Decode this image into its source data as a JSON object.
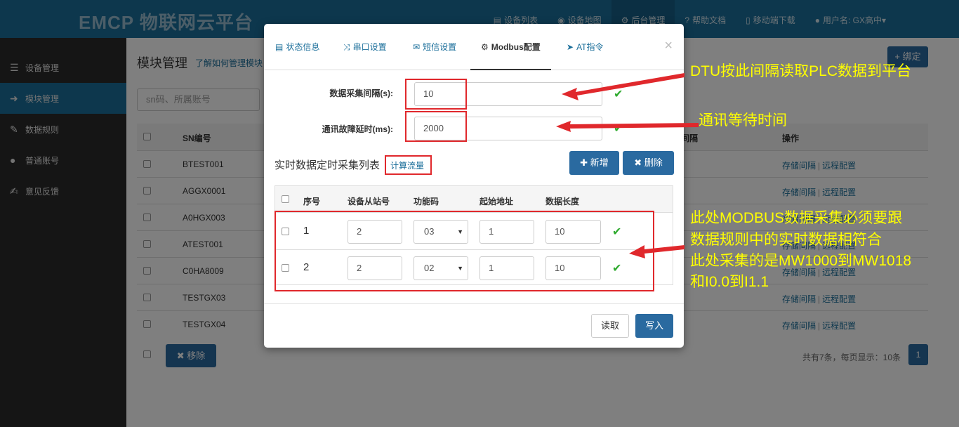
{
  "app": {
    "logo_text": "EMCP 物联网云平台"
  },
  "topnav": [
    {
      "icon": "list-icon",
      "glyph": "▤",
      "label": "设备列表"
    },
    {
      "icon": "globe-icon",
      "glyph": "◉",
      "label": "设备地图"
    },
    {
      "icon": "gears-icon",
      "glyph": "⚙",
      "label": "后台管理"
    },
    {
      "icon": "help-icon",
      "glyph": "?",
      "label": "帮助文档"
    },
    {
      "icon": "mobile-icon",
      "glyph": "▯",
      "label": "移动端下载"
    },
    {
      "icon": "user-icon",
      "glyph": "●",
      "label": "用户名: GX高中▾"
    }
  ],
  "sidebar": [
    {
      "icon": "th-list-icon",
      "glyph": "☰",
      "label": "设备管理"
    },
    {
      "icon": "sign-in-icon",
      "glyph": "➜",
      "label": "模块管理"
    },
    {
      "icon": "pencil-icon",
      "glyph": "✎",
      "label": "数据规则"
    },
    {
      "icon": "user-icon",
      "glyph": "●",
      "label": "普通账号"
    },
    {
      "icon": "edit-icon",
      "glyph": "✍",
      "label": "意见反馈"
    }
  ],
  "page": {
    "title": "模块管理",
    "help_link": "了解如何管理模块",
    "bind_button": "+ 绑定",
    "search_placeholder": "sn码、所属账号",
    "table_headers": {
      "sn": "SN编号",
      "interval": "间隔",
      "ops": "操作"
    },
    "rows": [
      {
        "sn": "BTEST001",
        "op1": "存储间隔",
        "op2": "远程配置"
      },
      {
        "sn": "AGGX0001",
        "op1": "存储间隔",
        "op2": "远程配置"
      },
      {
        "sn": "A0HGX003",
        "op1": "存储间隔",
        "op2": "远程配置"
      },
      {
        "sn": "ATEST001",
        "op1": "存储间隔",
        "op2": "远程配置"
      },
      {
        "sn": "C0HA8009",
        "op1": "存储间隔",
        "op2": "远程配置"
      },
      {
        "sn": "TESTGX03",
        "op1": "存储间隔",
        "op2": "远程配置"
      },
      {
        "sn": "TESTGX04",
        "op1": "存储间隔",
        "op2": "远程配置"
      }
    ],
    "op_separator": "|",
    "remove_button": "✖ 移除",
    "pager_info": "共有7条，每页显示：10条",
    "pager_current": "1"
  },
  "modal": {
    "tabs": [
      {
        "icon": "list-alt-icon",
        "glyph": "▤",
        "label": "状态信息"
      },
      {
        "icon": "random-icon",
        "glyph": "⤨",
        "label": "串口设置"
      },
      {
        "icon": "envelope-icon",
        "glyph": "✉",
        "label": "短信设置"
      },
      {
        "icon": "cog-icon",
        "glyph": "⚙",
        "label": "Modbus配置"
      },
      {
        "icon": "send-icon",
        "glyph": "➤",
        "label": "AT指令"
      }
    ],
    "close": "×",
    "interval_label": "数据采集间隔(s):",
    "interval_value": "10",
    "timeout_label": "通讯故障延时(ms):",
    "timeout_value": "2000",
    "list_title": "实时数据定时采集列表",
    "calc_link": "计算流量",
    "add_button": "✚ 新增",
    "delete_button": "✖ 删除",
    "table_headers": [
      "序号",
      "设备从站号",
      "功能码",
      "起始地址",
      "数据长度"
    ],
    "rows": [
      {
        "index": "1",
        "slave": "2",
        "func": "03",
        "start": "1",
        "length": "10"
      },
      {
        "index": "2",
        "slave": "2",
        "func": "02",
        "start": "1",
        "length": "10"
      }
    ],
    "check_glyph": "✔",
    "read_button": "读取",
    "write_button": "写入"
  },
  "annotations": {
    "a1": "DTU按此间隔读取PLC数据到平台",
    "a2": "通讯等待时间",
    "a3_lines": [
      "此处MODBUS数据采集必须要跟",
      "数据规则中的实时数据相符合",
      "此处采集的是MW1000到MW1018",
      "和I0.0到I1.1"
    ]
  },
  "colors": {
    "annotation_text": "#ffff00",
    "annotation_red": "#e0282c",
    "primary": "#2a6aa0",
    "success": "#2eaa2e"
  }
}
